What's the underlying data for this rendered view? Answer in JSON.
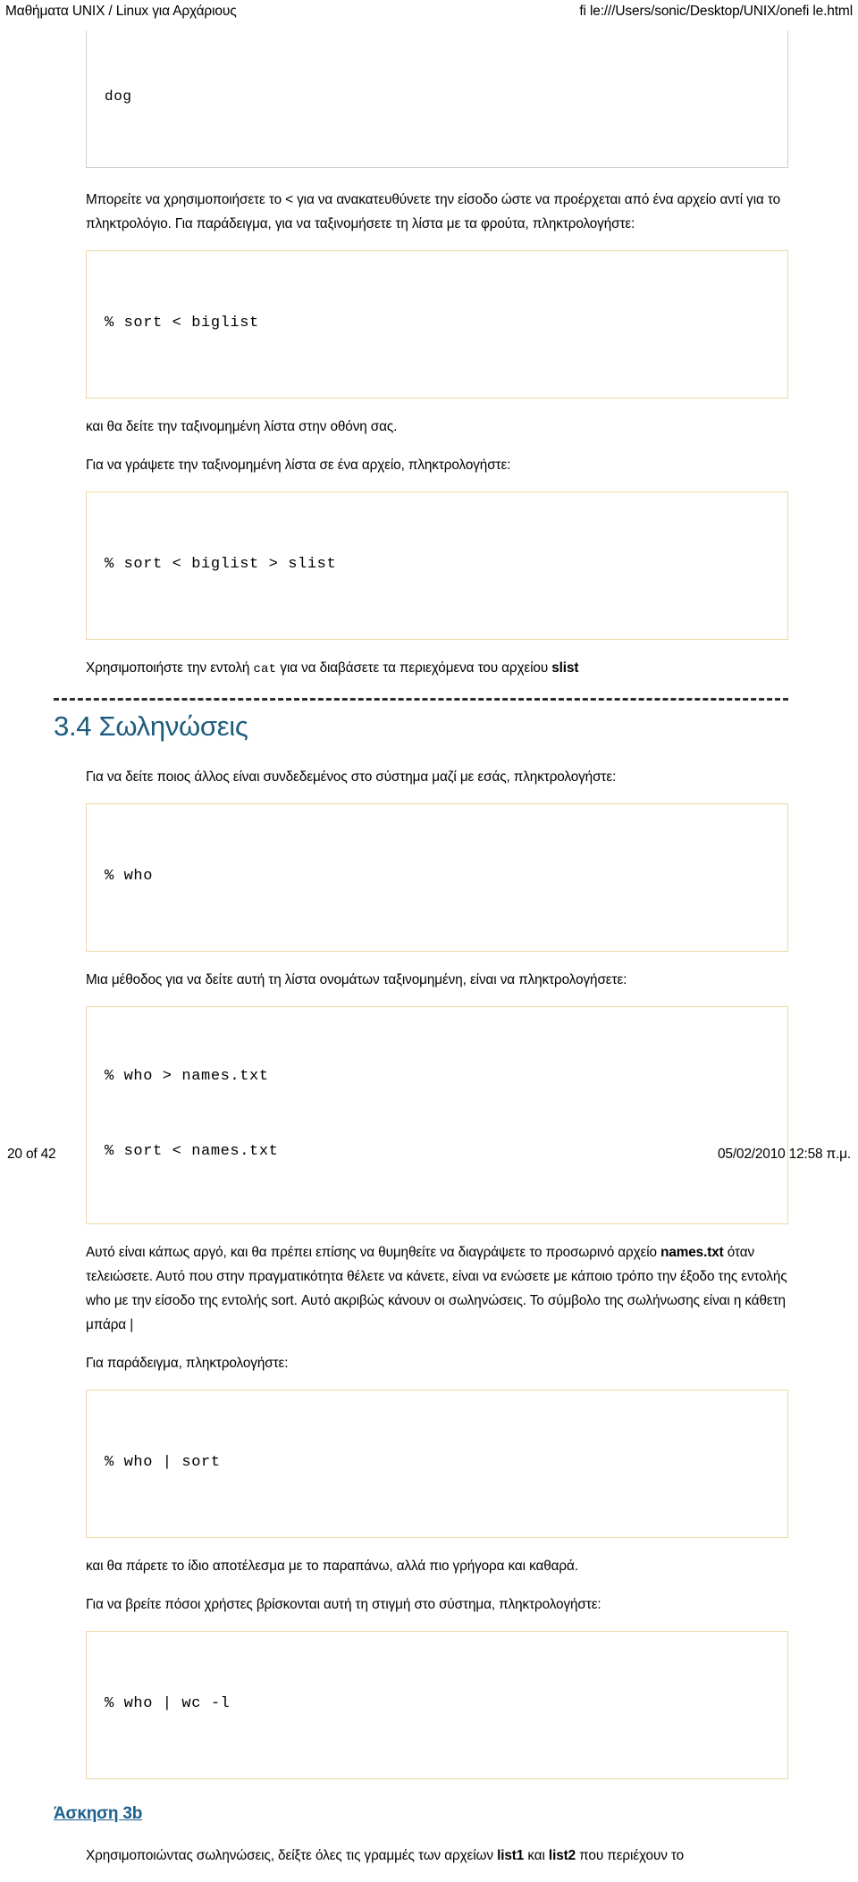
{
  "header": {
    "document_title": "Μαθήματα UNIX / Linux για Αρχάριους",
    "file_path": "fi  le:///Users/sonic/Desktop/UNIX/onefi  le.html"
  },
  "body": {
    "top_output_box": "dog",
    "para_redirect_input": "Μπορείτε να χρησιμοποιήσετε το < για να ανακατευθύνετε την είσοδο ώστε να προέρχεται από ένα αρχείο αντί για το πληκτρολόγιο. Για παράδειγμα, για να ταξινομήσετε τη λίστα με τα φρούτα, πληκτρολογήστε:",
    "code_sort_biglist": "% sort < biglist",
    "para_see_sorted": "και θα δείτε την ταξινομημένη λίστα στην οθόνη σας.",
    "para_write_to_file": "Για να γράψετε την ταξινομημένη λίστα σε ένα αρχείο, πληκτρολογήστε:",
    "code_sort_biglist_slist": "% sort < biglist > slist",
    "para_use_cat_pre": "Χρησιμοποιήστε την εντολή ",
    "para_use_cat_cmd": "cat",
    "para_use_cat_mid": " για να διαβάσετε τα περιεχόμενα του αρχείου ",
    "para_use_cat_file": "slist",
    "section_title": "3.4 Σωληνώσεις",
    "para_who_intro": "Για να δείτε ποιος άλλος είναι συνδεδεμένος στο σύστημα μαζί με εσάς, πληκτρολογήστε:",
    "code_who": "% who",
    "para_method_sorted": "Μια μέθοδος για να δείτε αυτή τη λίστα ονομάτων ταξινομημένη, είναι να πληκτρολογήσετε:",
    "code_who_names_line1": "% who > names.txt",
    "code_who_names_line2": "% sort < names.txt",
    "para_slow_pre": "Αυτό είναι κάπως αργό, και θα πρέπει επίσης να θυμηθείτε να διαγράψετε το προσωρινό αρχείο ",
    "para_slow_file": "names.txt",
    "para_slow_post": " όταν τελειώσετε. Αυτό που στην πραγματικότητα θέλετε να κάνετε, είναι να ενώσετε με κάποιο τρόπο την έξοδο της εντολής who με την είσοδο της εντολής sort. Αυτό ακριβώς κάνουν οι σωληνώσεις. Το σύμβολο της σωλήνωσης είναι η κάθετη μπάρα |",
    "para_for_example": "Για παράδειγμα, πληκτρολογήστε:",
    "code_who_pipe_sort": "% who | sort",
    "para_same_result": "και θα πάρετε το ίδιο αποτέλεσμα με το παραπάνω, αλλά πιο γρήγορα και καθαρά.",
    "para_count_users": "Για να βρείτε πόσοι χρήστες βρίσκονται αυτή τη στιγμή στο σύστημα, πληκτρολογήστε:",
    "code_who_pipe_wc": "% who | wc -l",
    "exercise_link": "Άσκηση 3b",
    "para_exercise_pre": "Χρησιμοποιώντας σωληνώσεις, δείξτε όλες τις γραμμές των αρχείων ",
    "para_exercise_file1": "list1",
    "para_exercise_mid": " και ",
    "para_exercise_file2": "list2",
    "para_exercise_post": " που περιέχουν το"
  },
  "footer": {
    "page_indicator": "20 of 42",
    "timestamp": "05/02/2010 12:58 π.μ."
  },
  "colors": {
    "heading_blue": "#1d5c7e",
    "link_blue": "#1c5f8e",
    "code_border": "#f0d8a8",
    "output_border": "#cfcfcf"
  }
}
